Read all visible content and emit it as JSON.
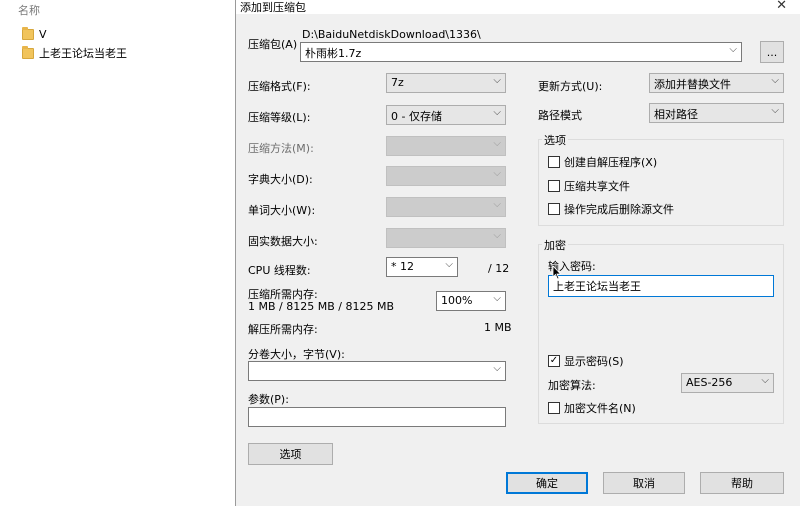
{
  "explorer": {
    "column_header": "名称",
    "items": [
      {
        "label": "V"
      },
      {
        "label": "上老王论坛当老王"
      }
    ]
  },
  "dialog": {
    "title": "添加到压缩包",
    "archive": {
      "label": "压缩包(A)",
      "path": "D:\\BaiduNetdiskDownload\\1336\\",
      "value": "朴雨彬1.7z",
      "browse_label": "..."
    },
    "left": {
      "format_label": "压缩格式(F):",
      "format_value": "7z",
      "level_label": "压缩等级(L):",
      "level_value": "0 - 仅存储",
      "method_label": "压缩方法(M):",
      "dict_label": "字典大小(D):",
      "word_label": "单词大小(W):",
      "solid_label": "固实数据大小:",
      "cpu_label": "CPU 线程数:",
      "cpu_value": "* 12",
      "cpu_total": "/ 12",
      "mem_label": "压缩所需内存:",
      "mem_value": "1 MB / 8125 MB / 8125 MB",
      "mem_percent": "100%",
      "decomp_label": "解压所需内存:",
      "decomp_value": "1 MB",
      "volume_label": "分卷大小，字节(V):",
      "volume_value": "",
      "params_label": "参数(P):",
      "params_value": "",
      "options_button": "选项"
    },
    "right": {
      "update_label": "更新方式(U):",
      "update_value": "添加并替换文件",
      "path_label": "路径模式",
      "path_value": "相对路径",
      "options_group": "选项",
      "opt_sfx": "创建自解压程序(X)",
      "opt_shared": "压缩共享文件",
      "opt_delete": "操作完成后删除源文件",
      "encrypt_group": "加密",
      "password_label": "输入密码:",
      "password_value": "上老王论坛当老王",
      "show_password": "显示密码(S)",
      "show_password_check": "✓",
      "algo_label": "加密算法:",
      "algo_value": "AES-256",
      "encrypt_names": "加密文件名(N)"
    },
    "buttons": {
      "ok": "确定",
      "cancel": "取消",
      "help": "帮助"
    },
    "icons": {
      "dropdown": "⌵",
      "close": "✕"
    }
  }
}
